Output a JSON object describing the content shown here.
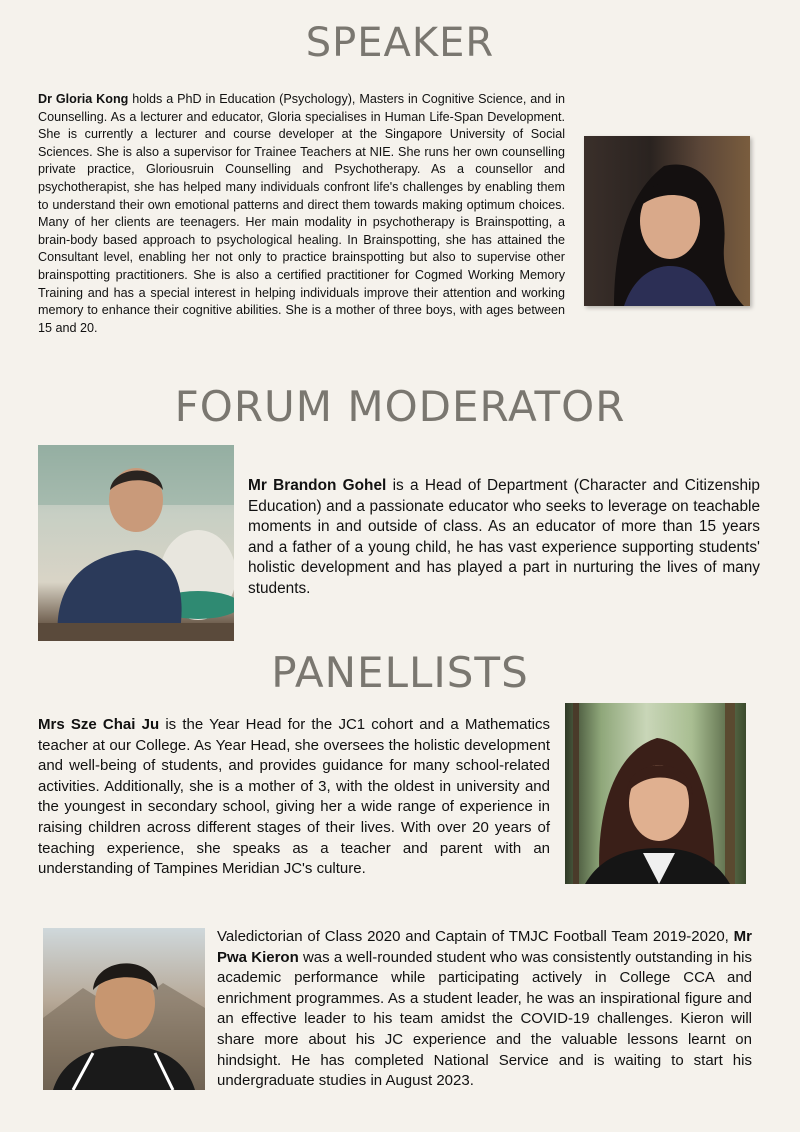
{
  "speaker": {
    "heading": "SPEAKER",
    "name": "Dr Gloria Kong",
    "bio": " holds a PhD in Education (Psychology), Masters in Cognitive Science, and in Counselling. As a lecturer and educator, Gloria specialises in Human Life-Span Development. She is currently a lecturer and course developer at the Singapore University of Social Sciences. She is also a supervisor for Trainee Teachers at NIE. She runs her own counselling private practice, Gloriousruin Counselling and Psychotherapy. As a counsellor and psychotherapist, she has helped many individuals confront life's challenges by enabling them to understand their own emotional patterns and direct them towards making optimum choices. Many of her clients are teenagers. Her main modality in psychotherapy is Brainspotting, a brain-body based approach to psychological healing. In Brainspotting, she has attained the Consultant level, enabling her not only to practice brainspotting but also to supervise other brainspotting practitioners. She is also a certified practitioner for Cogmed Working Memory Training and has a special interest in helping individuals improve their attention and working memory to enhance their cognitive abilities. She is a mother of three boys, with ages between 15 and 20."
  },
  "moderator": {
    "heading": "FORUM MODERATOR",
    "name": "Mr Brandon Gohel",
    "bio": " is a Head of Department (Character and Citizenship Education) and a passionate educator who seeks to leverage on teachable moments in and outside of class. As an educator of more than 15 years and a father of a young child, he has vast experience supporting students' holistic development and has played a part in nurturing the lives of many students."
  },
  "panellists": {
    "heading": "PANELLISTS",
    "sze": {
      "name": "Mrs Sze Chai Ju",
      "bio": " is the Year Head for the JC1 cohort and a Mathematics teacher at our College. As Year Head, she oversees the holistic development and well-being of students, and provides guidance for many school-related activities. Additionally, she is a mother of 3, with the oldest in university and the youngest in secondary school, giving her a wide range of experience in raising children across different stages of their lives. With over 20 years of teaching experience, she speaks as a teacher and parent with an understanding of Tampines Meridian JC's culture."
    },
    "pwa": {
      "intro": "Valedictorian of Class 2020 and Captain of TMJC Football Team 2019-2020, ",
      "name": "Mr Pwa Kieron",
      "bio": " was a well-rounded student who was consistently outstanding in his academic performance while participating actively in College CCA and enrichment programmes. As a student leader, he was an inspirational figure and an effective leader to his team amidst the COVID-19 challenges. Kieron will share more about his JC experience and the valuable lessons learnt on hindsight. He has completed National Service and is waiting to start his undergraduate studies in August 2023."
    }
  }
}
